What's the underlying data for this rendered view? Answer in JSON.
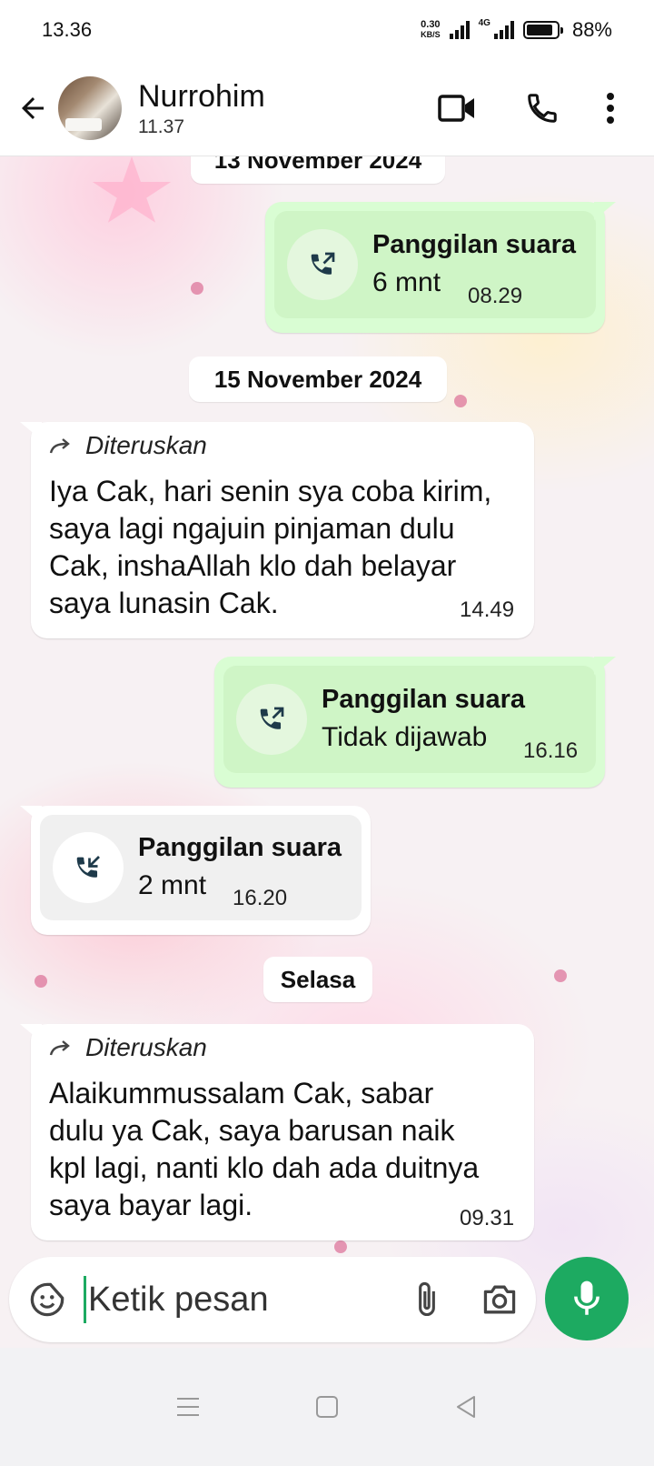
{
  "status_bar": {
    "time": "13.36",
    "net_speed_value": "0.30",
    "net_speed_unit": "KB/S",
    "network_type": "4G",
    "battery_level": 0.88,
    "battery_percent": "88%"
  },
  "header": {
    "contact_name": "Nurrohim",
    "last_seen": "11.37"
  },
  "chat": {
    "date_top": "13 November 2024",
    "date_15": "15 November 2024",
    "date_selasa": "Selasa",
    "call1": {
      "title": "Panggilan suara",
      "detail": "6 mnt",
      "time": "08.29"
    },
    "msg1": {
      "forwarded_label": "Diteruskan",
      "lines": [
        "Iya Cak, hari senin sya coba kirim,",
        "saya lagi ngajuin pinjaman dulu",
        "Cak, inshaAllah klo dah belayar",
        "saya lunasin Cak."
      ],
      "time": "14.49"
    },
    "call2": {
      "title": "Panggilan suara",
      "detail": "Tidak dijawab",
      "time": "16.16"
    },
    "call3": {
      "title": "Panggilan suara",
      "detail": "2 mnt",
      "time": "16.20"
    },
    "msg2": {
      "forwarded_label": "Diteruskan",
      "lines": [
        "Alaikummussalam Cak, sabar",
        "dulu ya Cak, saya barusan naik",
        "kpl lagi, nanti klo dah ada duitnya",
        "saya bayar lagi."
      ],
      "time": "09.31"
    }
  },
  "composer": {
    "placeholder": "Ketik pesan"
  },
  "colors": {
    "outgoing_bubble": "#d9fdd3",
    "accent_green": "#1daa61",
    "incoming_bubble": "#ffffff"
  },
  "icons": {
    "back": "arrow-left-icon",
    "video": "video-call-icon",
    "phone": "phone-icon",
    "menu": "more-vert-icon",
    "call_out": "outgoing-call-icon",
    "call_in": "incoming-call-icon",
    "forward": "forward-icon",
    "sticker": "sticker-icon",
    "attach": "paperclip-icon",
    "camera": "camera-icon",
    "mic": "mic-icon"
  }
}
